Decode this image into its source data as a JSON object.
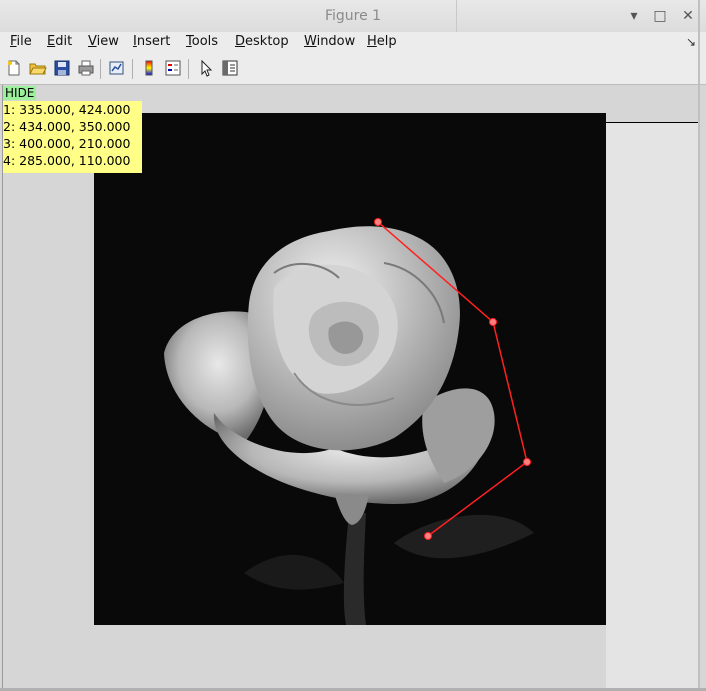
{
  "window": {
    "title": "Figure 1",
    "minimize_glyph": "▾",
    "maximize_glyph": "□",
    "close_glyph": "✕"
  },
  "menubar": {
    "items": [
      {
        "label": "File",
        "accel": "F",
        "rest": "ile"
      },
      {
        "label": "Edit",
        "accel": "E",
        "rest": "dit"
      },
      {
        "label": "View",
        "accel": "V",
        "rest": "iew"
      },
      {
        "label": "Insert",
        "accel": "I",
        "rest": "nsert"
      },
      {
        "label": "Tools",
        "accel": "T",
        "rest": "ools"
      },
      {
        "label": "Desktop",
        "accel": "D",
        "rest": "esktop"
      },
      {
        "label": "Window",
        "accel": "W",
        "rest": "indow"
      },
      {
        "label": "Help",
        "accel": "H",
        "rest": "elp"
      }
    ],
    "dock_arrow": "↘"
  },
  "toolbar": {
    "buttons": [
      "new-figure-icon",
      "open-file-icon",
      "save-icon",
      "print-icon",
      "link-plot-icon",
      "colorbar-icon",
      "legend-icon",
      "edit-pointer-icon",
      "property-editor-icon"
    ]
  },
  "overlay": {
    "hide_label": "HIDE",
    "points_text": [
      "1: 335.000, 424.000",
      "2: 434.000, 350.000",
      "3: 400.000, 210.000",
      "4: 285.000, 110.000"
    ]
  },
  "polyline": {
    "color": "#ff2020",
    "marker_fill": "#ff8080"
  },
  "image": {
    "subject": "grayscale white rose on black background"
  }
}
